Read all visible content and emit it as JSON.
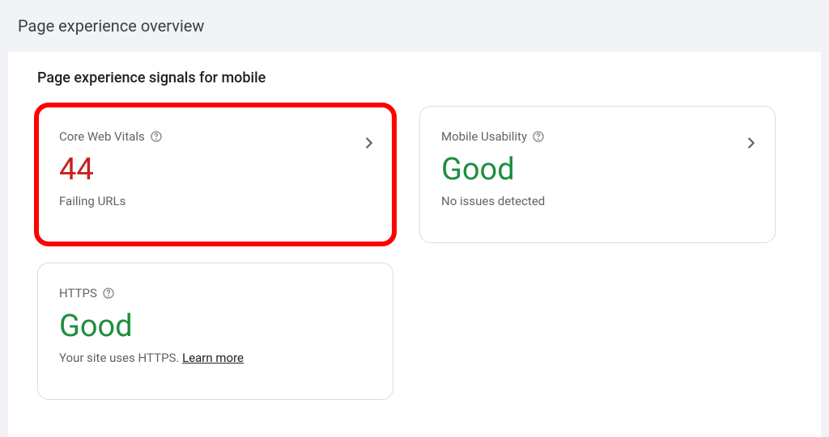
{
  "header": {
    "title": "Page experience overview"
  },
  "section": {
    "title": "Page experience signals for mobile"
  },
  "cards": {
    "core_web_vitals": {
      "title": "Core Web Vitals",
      "value": "44",
      "subtext": "Failing URLs",
      "has_chevron": true,
      "highlighted": true,
      "value_color": "red"
    },
    "mobile_usability": {
      "title": "Mobile Usability",
      "value": "Good",
      "subtext": "No issues detected",
      "has_chevron": true,
      "value_color": "green"
    },
    "https": {
      "title": "HTTPS",
      "value": "Good",
      "subtext_prefix": "Your site uses HTTPS. ",
      "learn_more": "Learn more",
      "has_chevron": false,
      "value_color": "green"
    }
  }
}
